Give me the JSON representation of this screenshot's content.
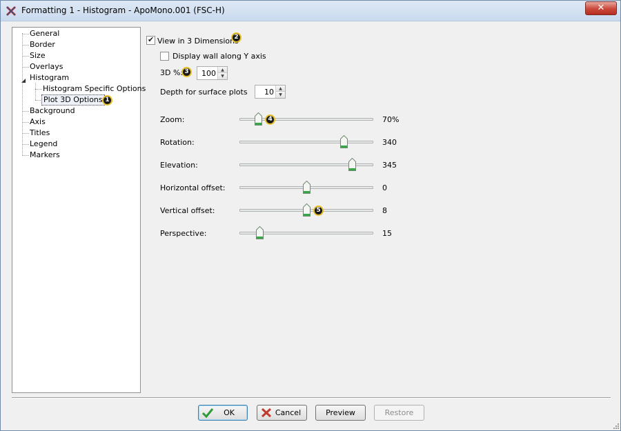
{
  "window": {
    "title": "Formatting 1 - Histogram - ApoMono.001 (FSC-H)",
    "close_label": "✕"
  },
  "tree": {
    "items": [
      {
        "label": "General"
      },
      {
        "label": "Border"
      },
      {
        "label": "Size"
      },
      {
        "label": "Overlays"
      },
      {
        "label": "Histogram"
      },
      {
        "label": "Histogram Specific Options"
      },
      {
        "label": "Plot 3D Options"
      },
      {
        "label": "Background"
      },
      {
        "label": "Axis"
      },
      {
        "label": "Titles"
      },
      {
        "label": "Legend"
      },
      {
        "label": "Markers"
      }
    ],
    "selected": "Plot 3D Options",
    "marker": "1"
  },
  "options": {
    "view3d": {
      "label": "View in 3 Dimensions",
      "checked": true,
      "marker": "2"
    },
    "wall_y": {
      "label": "Display wall along Y axis",
      "checked": false
    },
    "pct3d": {
      "label": "3D %:",
      "value": "100",
      "marker": "3"
    },
    "depth": {
      "label": "Depth for surface plots",
      "value": "10"
    }
  },
  "sliders": [
    {
      "label": "Zoom:",
      "value": "70%",
      "level": 0.14,
      "marker": "4"
    },
    {
      "label": "Rotation:",
      "value": "340",
      "level": 0.78
    },
    {
      "label": "Elevation:",
      "value": "345",
      "level": 0.84
    },
    {
      "label": "Horizontal offset:",
      "value": "0",
      "level": 0.5
    },
    {
      "label": "Vertical offset:",
      "value": "8",
      "level": 0.5,
      "marker": "5"
    },
    {
      "label": "Perspective:",
      "value": "15",
      "level": 0.15
    }
  ],
  "buttons": {
    "ok": "OK",
    "cancel": "Cancel",
    "preview": "Preview",
    "restore": "Restore"
  },
  "colors": {
    "accent": "#3c7fb1",
    "marker_ring": "#e8c12a",
    "thumb_green": "#3aa64a"
  }
}
